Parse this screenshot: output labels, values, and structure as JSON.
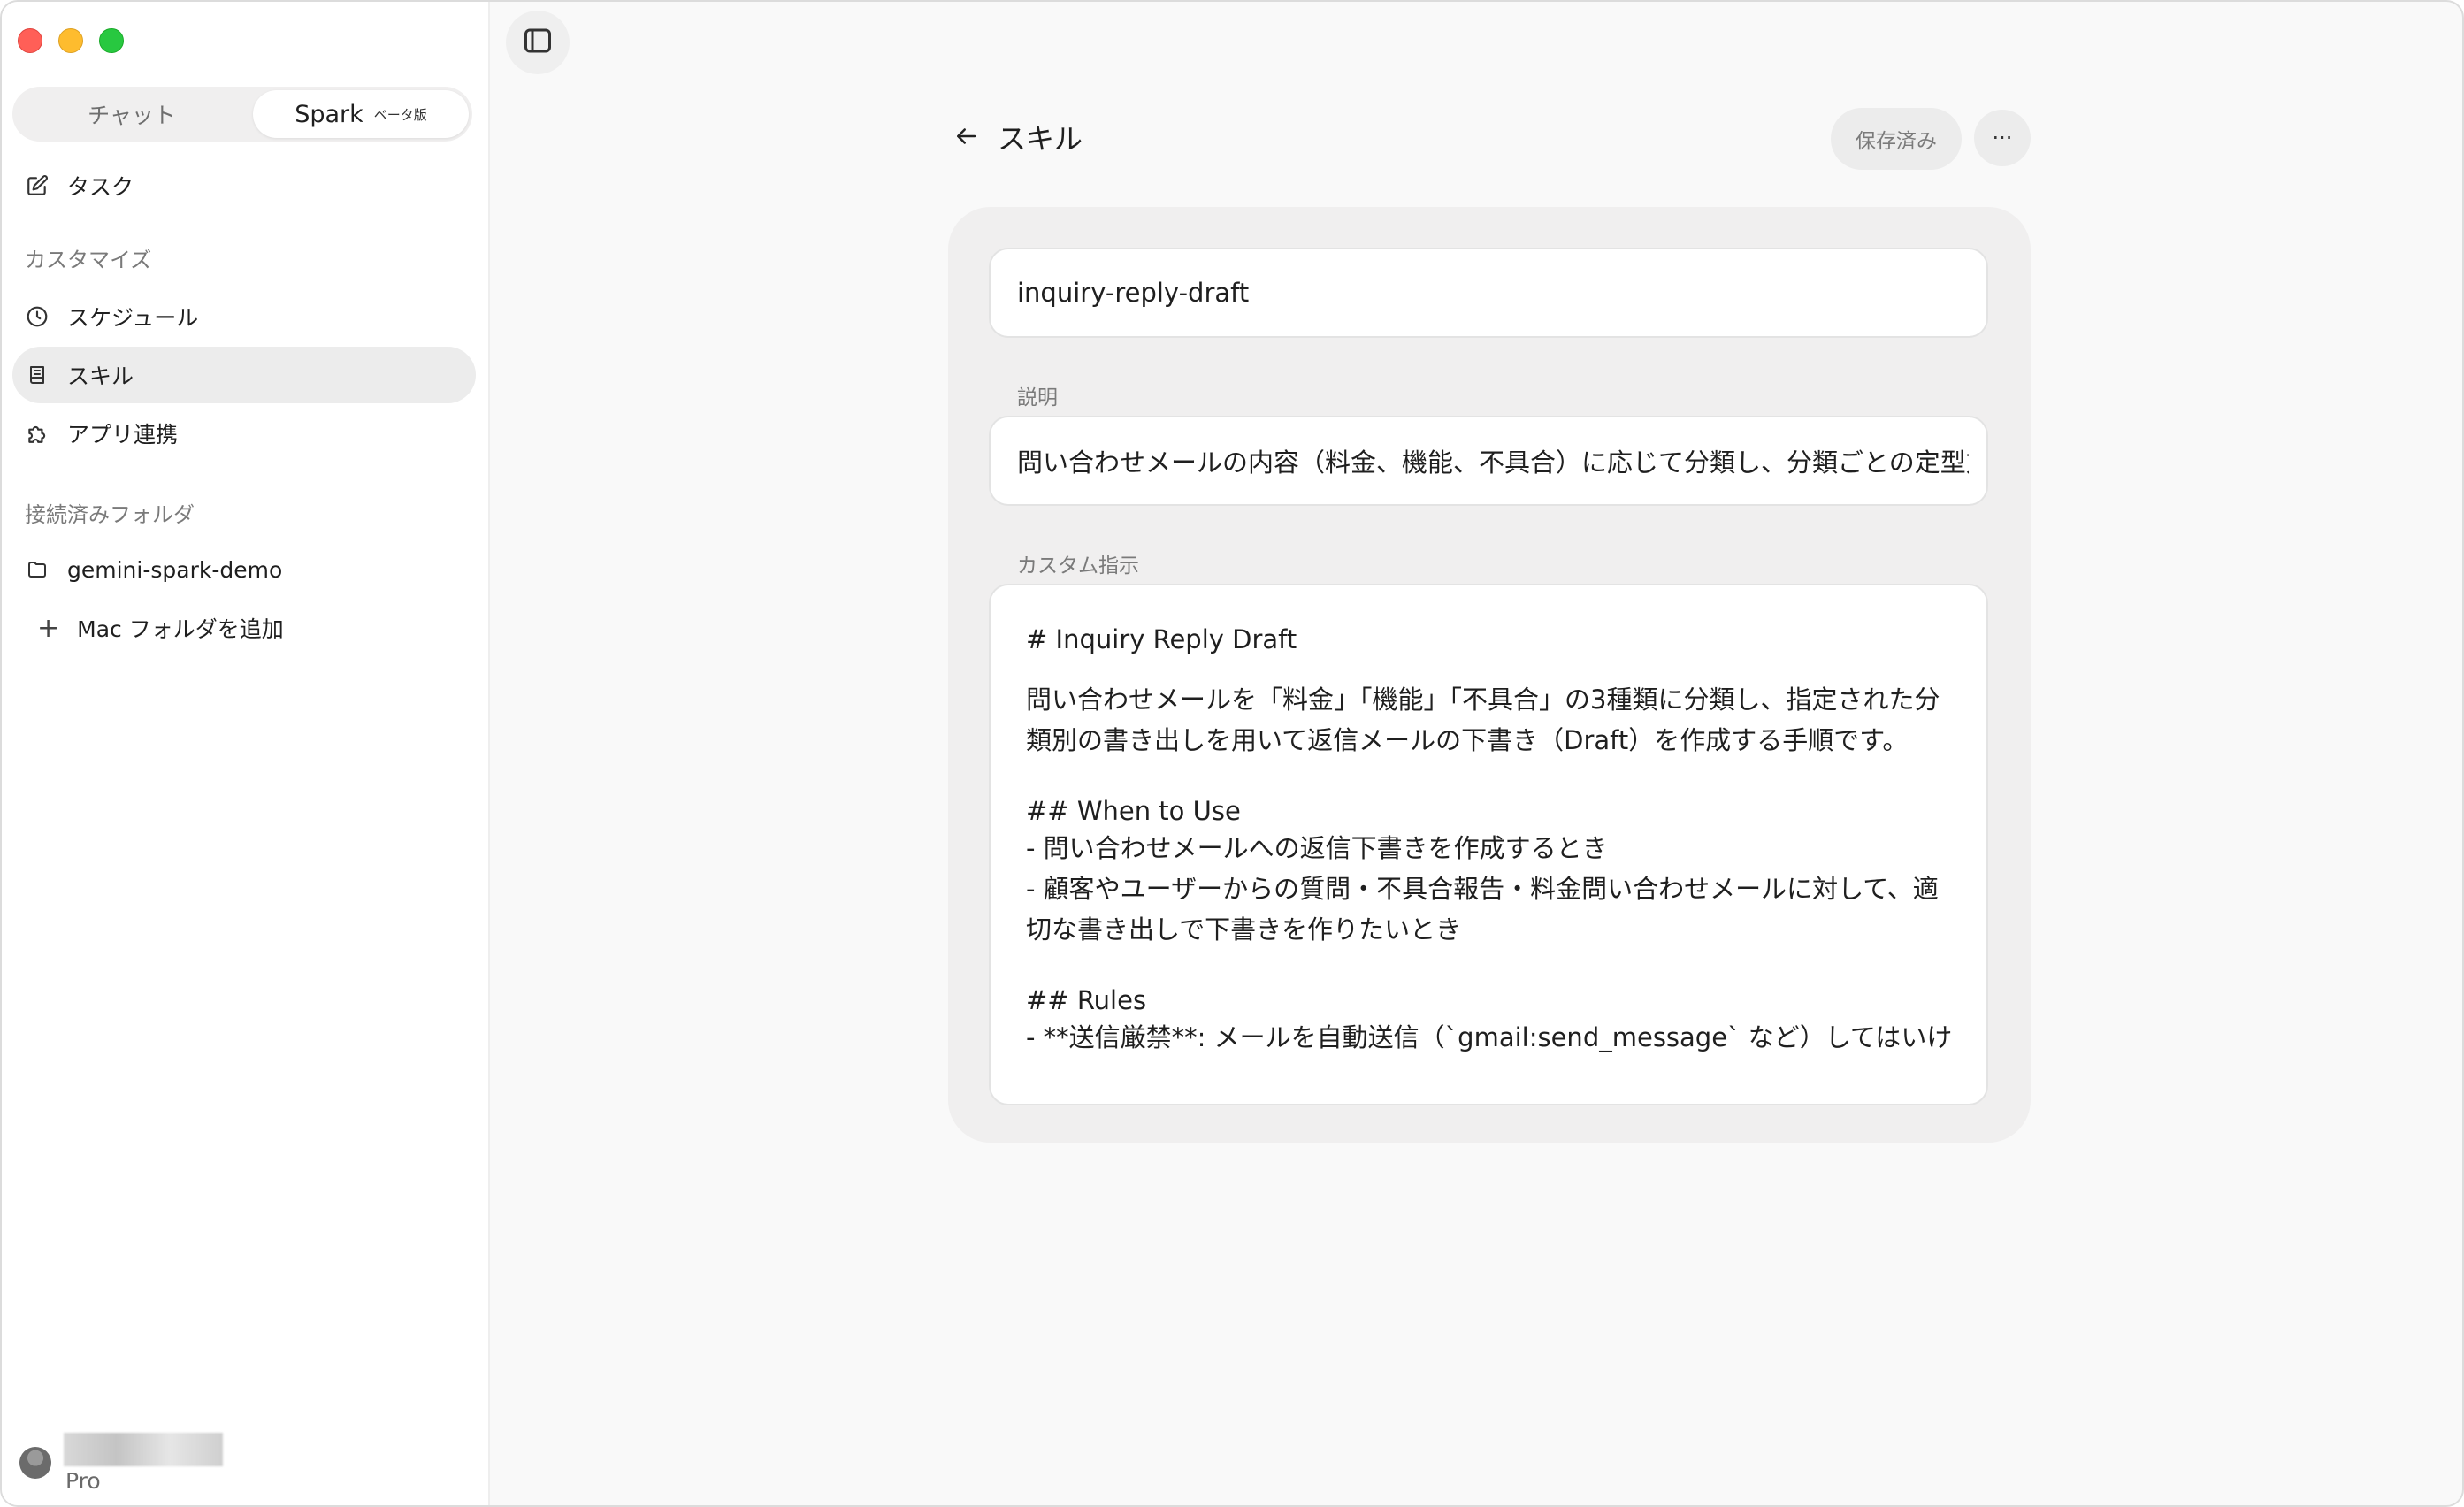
{
  "sidebar": {
    "segment": {
      "chat": "チャット",
      "spark": "Spark",
      "beta": "ベータ版"
    },
    "task": "タスク",
    "customize_label": "カスタマイズ",
    "schedule": "スケジュール",
    "skill": "スキル",
    "app_integration": "アプリ連携",
    "connected_folders_label": "接続済みフォルダ",
    "folder": "gemini-spark-demo",
    "add_folder": "Mac フォルダを追加",
    "user": {
      "plan": "Pro"
    }
  },
  "header": {
    "title": "スキル",
    "saved_button": "保存済み",
    "more_button": "···"
  },
  "form": {
    "name_value": "inquiry-reply-draft",
    "description_label": "説明",
    "description_value": "問い合わせメールの内容（料金、機能、不具合）に応じて分類し、分類ごとの定型文・",
    "custom_label": "カスタム指示",
    "custom_lines": {
      "h1": "# Inquiry Reply Draft",
      "p1": "問い合わせメールを「料金」「機能」「不具合」の3種類に分類し、指定された分類別の書き出しを用いて返信メールの下書き（Draft）を作成する手順です。",
      "h2": "## When to Use",
      "li1": "- 問い合わせメールへの返信下書きを作成するとき",
      "li2": "- 顧客やユーザーからの質問・不具合報告・料金問い合わせメールに対して、適切な書き出しで下書きを作りたいとき",
      "h3": "## Rules",
      "li3": "- **送信厳禁**: メールを自動送信（`gmail:send_message` など）してはいけ"
    }
  }
}
